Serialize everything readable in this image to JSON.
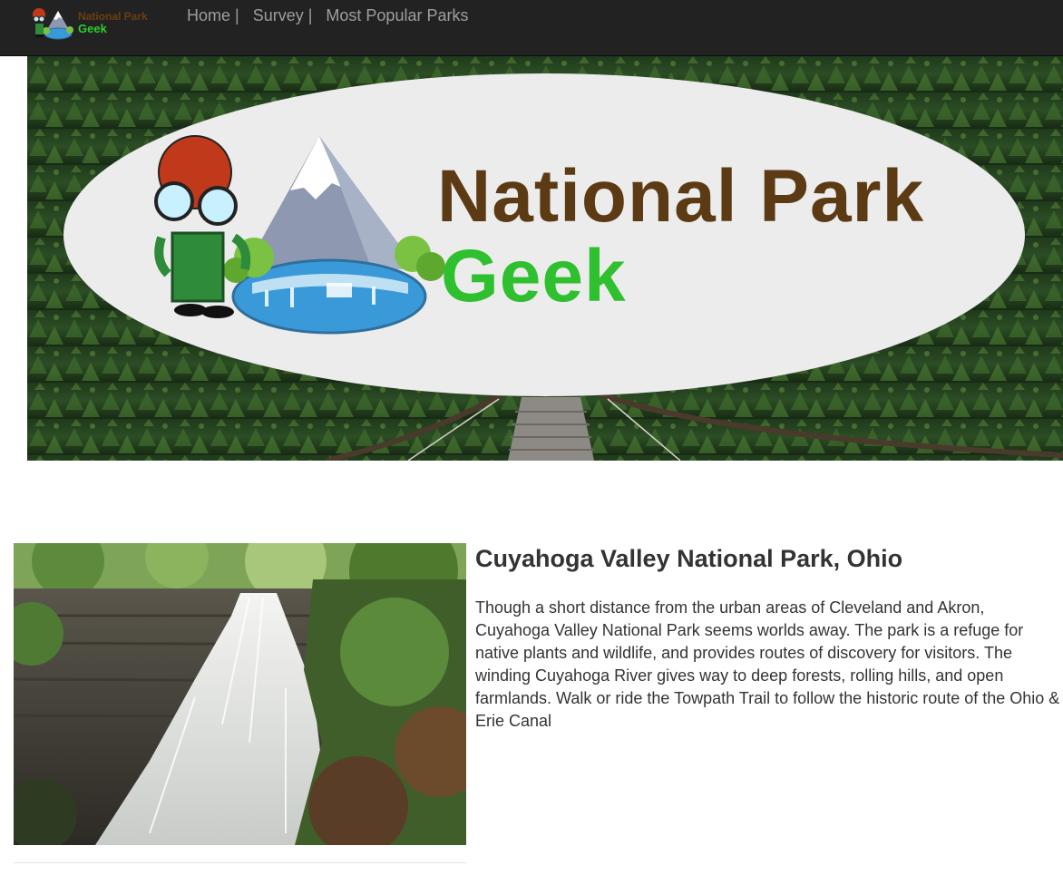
{
  "brand": {
    "line1": "National Park",
    "line2": "Geek"
  },
  "nav": {
    "items": [
      {
        "label": "Home |"
      },
      {
        "label": "Survey |"
      },
      {
        "label": "Most Popular Parks"
      }
    ]
  },
  "hero": {
    "title_line1": "National Park",
    "title_line2": "Geek"
  },
  "park": {
    "title": "Cuyahoga Valley National Park, Ohio",
    "description": "Though a short distance from the urban areas of Cleveland and Akron, Cuyahoga Valley National Park seems worlds away. The park is a refuge for native plants and wildlife, and provides routes of discovery for visitors. The winding Cuyahoga River gives way to deep forests, rolling hills, and open farmlands. Walk or ride the Towpath Trail to follow the historic route of the Ohio & Erie Canal"
  },
  "colors": {
    "navbar": "#222222",
    "nav_link": "#9d9d9d",
    "brand_brown": "#5c3a14",
    "brand_green": "#2ec02e",
    "text": "#333333"
  },
  "icons": {
    "logo": "geek-mountain-logo-icon"
  }
}
